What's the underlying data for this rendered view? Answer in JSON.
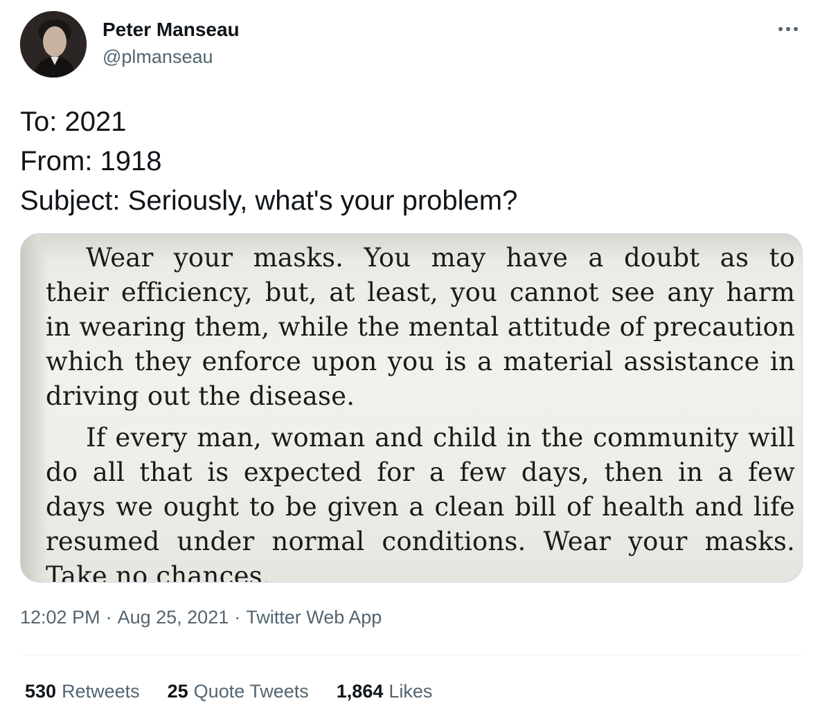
{
  "author": {
    "display_name": "Peter Manseau",
    "handle": "@plmanseau",
    "avatar_icon": "profile-photo"
  },
  "more_icon": "more-horizontal-icon",
  "tweet": {
    "lines": [
      "To: 2021",
      "From: 1918",
      "Subject: Seriously, what's your problem?"
    ]
  },
  "media": {
    "clipping_lines": [
      "Wear your masks.  You may have a doubt as to",
      "their efficiency, but, at least, you cannot see any harm",
      "in wearing them, while the mental attitude of precaution",
      "which they enforce upon you is a material assistance in",
      "driving out the disease.",
      "If every man, woman and child in the community will",
      "do all that is expected for a few days, then in a few",
      "days we ought to be given a clean bill of health and life",
      "resumed under normal conditions.  Wear your masks.",
      "Take no chances."
    ]
  },
  "meta": {
    "time": "12:02 PM",
    "separator": "·",
    "date": "Aug 25, 2021",
    "source": "Twitter Web App"
  },
  "stats": {
    "retweets_count": "530",
    "retweets_label": "Retweets",
    "quotes_count": "25",
    "quotes_label": "Quote Tweets",
    "likes_count": "1,864",
    "likes_label": "Likes"
  },
  "colors": {
    "text_primary": "#0f1419",
    "text_secondary": "#536471",
    "border": "#cfd9de",
    "divider": "#eff3f4"
  }
}
